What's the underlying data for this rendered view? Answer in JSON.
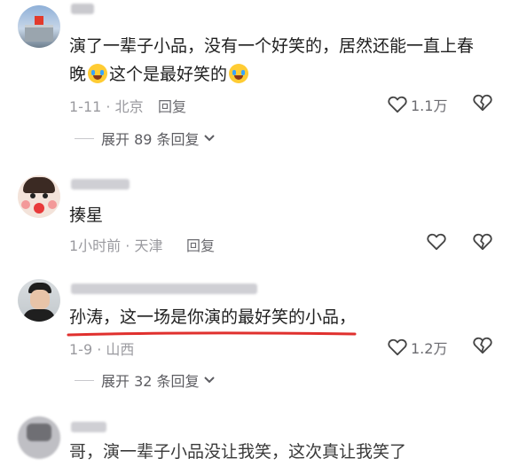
{
  "comments": [
    {
      "text_line1": "演了一辈子小品，没有一个好笑的，居然还能一直上春",
      "text_line2_prefix": "晚",
      "text_line2_middle": "这个是最好笑的",
      "date_location": "1-11 · 北京",
      "reply_label": "回复",
      "likes": "1.1万",
      "expand_label": "展开 89 条回复"
    },
    {
      "text": "揍星",
      "date_location": "1小时前 · 天津",
      "reply_label": "回复"
    },
    {
      "text": "孙涛，这一场是你演的最好笑的小品，",
      "date_location": "1-9 · 山西",
      "likes": "1.2万",
      "expand_label": "展开 32 条回复"
    },
    {
      "text_partial": "哥，演一辈子小品没让我笑，这次真让我笑了"
    }
  ],
  "icons": {
    "like": "heart-outline-icon",
    "dislike": "broken-heart-icon",
    "expand": "chevron-down-icon",
    "emoji": "laugh-cry-emoji"
  },
  "colors": {
    "text": "#1f1f1f",
    "meta": "#9a9a9f",
    "underline": "#e0302e"
  }
}
